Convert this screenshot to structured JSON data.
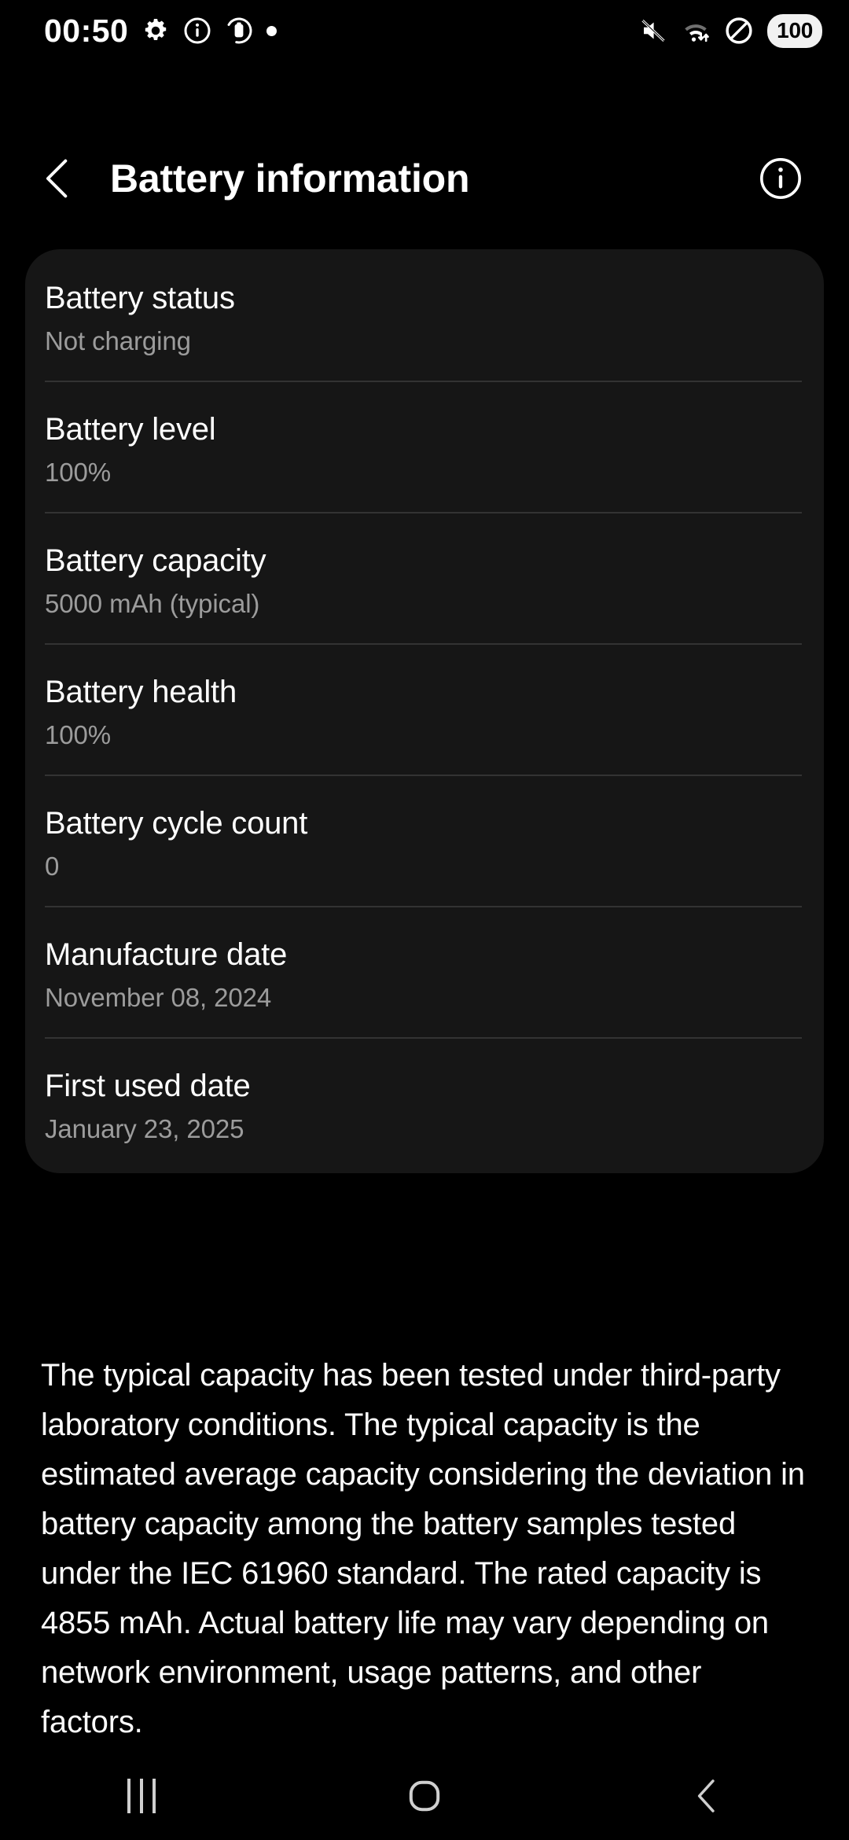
{
  "status_bar": {
    "time": "00:50",
    "left_icons": [
      "gear-icon",
      "info-circle-icon",
      "battery-saver-icon",
      "dot-icon"
    ],
    "right_icons": [
      "mute-icon",
      "wifi-transfer-icon",
      "do-not-disturb-icon"
    ],
    "battery_percent": "100"
  },
  "header": {
    "back_icon": "chevron-left-icon",
    "title": "Battery information",
    "info_icon": "info-circle-icon"
  },
  "card": {
    "rows": [
      {
        "title": "Battery status",
        "value": "Not charging"
      },
      {
        "title": "Battery level",
        "value": "100%"
      },
      {
        "title": "Battery capacity",
        "value": "5000 mAh (typical)"
      },
      {
        "title": "Battery health",
        "value": "100%"
      },
      {
        "title": "Battery cycle count",
        "value": "0"
      },
      {
        "title": "Manufacture date",
        "value": "November 08, 2024"
      },
      {
        "title": "First used date",
        "value": "January 23, 2025"
      }
    ]
  },
  "footnote": {
    "text": "The typical capacity has been tested under third-party laboratory conditions. The typical capacity is the estimated average capacity considering the deviation in battery capacity among the battery samples tested under the IEC 61960 standard. The rated capacity is 4855 mAh. Actual battery life may vary depending on network environment, usage patterns, and other factors."
  },
  "nav_bar": {
    "recents_label": "recents-icon",
    "home_label": "home-icon",
    "back_label": "back-icon"
  },
  "colors": {
    "background": "#000000",
    "card": "#161616",
    "divider": "#333333",
    "primary_text": "#ffffff",
    "secondary_text": "#9c9c9c",
    "nav_icon": "#cfcfcf"
  }
}
